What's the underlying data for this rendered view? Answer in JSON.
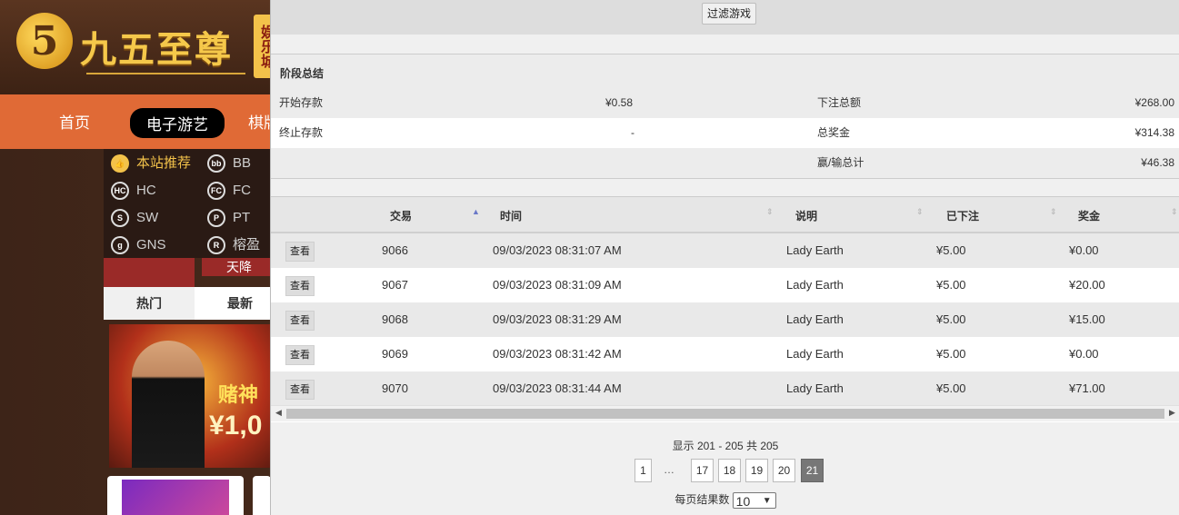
{
  "site": {
    "logo_glyph": "5",
    "logo_text": "九五至尊",
    "logo_tag": "娱乐城",
    "nav": [
      "首页",
      "电子游艺",
      "棋牌"
    ],
    "menu": [
      {
        "label": "本站推荐",
        "icon": "thumbs-up-icon"
      },
      {
        "label": "BB",
        "icon": "bb-icon"
      },
      {
        "label": "HC",
        "icon": "hc-icon"
      },
      {
        "label": "FC",
        "icon": "fc-icon"
      },
      {
        "label": "SW",
        "icon": "sw-icon"
      },
      {
        "label": "PT",
        "icon": "pt-icon"
      },
      {
        "label": "GNS",
        "icon": "gns-icon"
      },
      {
        "label": "榕盈",
        "icon": "rong-icon"
      }
    ],
    "banner_text": "天降",
    "tabs": [
      "热门",
      "最新"
    ],
    "promo_title": "赌神",
    "promo_amount": "¥1,0"
  },
  "filter": {
    "button": "过滤游戏"
  },
  "summary": {
    "title": "阶段总结",
    "start_balance_label": "开始存款",
    "start_balance": "¥0.58",
    "end_balance_label": "终止存款",
    "end_balance": "-",
    "total_bet_label": "下注总额",
    "total_bet": "¥268.00",
    "total_prize_label": "总奖金",
    "total_prize": "¥314.38",
    "win_loss_label": "赢/输总计",
    "win_loss": "¥46.38"
  },
  "grid": {
    "headers": [
      "交易",
      "时间",
      "说明",
      "已下注",
      "奖金"
    ],
    "view_label": "查看",
    "rows": [
      {
        "id": "9066",
        "time": "09/03/2023 08:31:07 AM",
        "desc": "Lady Earth",
        "bet": "¥5.00",
        "prize": "¥0.00"
      },
      {
        "id": "9067",
        "time": "09/03/2023 08:31:09 AM",
        "desc": "Lady Earth",
        "bet": "¥5.00",
        "prize": "¥20.00"
      },
      {
        "id": "9068",
        "time": "09/03/2023 08:31:29 AM",
        "desc": "Lady Earth",
        "bet": "¥5.00",
        "prize": "¥15.00"
      },
      {
        "id": "9069",
        "time": "09/03/2023 08:31:42 AM",
        "desc": "Lady Earth",
        "bet": "¥5.00",
        "prize": "¥0.00"
      },
      {
        "id": "9070",
        "time": "09/03/2023 08:31:44 AM",
        "desc": "Lady Earth",
        "bet": "¥5.00",
        "prize": "¥71.00"
      }
    ]
  },
  "pager": {
    "info": "显示 201 - 205 共 205",
    "pages": [
      "1",
      "…",
      "17",
      "18",
      "19",
      "20",
      "21"
    ],
    "current": "21",
    "per_page_label": "每页结果数",
    "per_page": "10"
  }
}
